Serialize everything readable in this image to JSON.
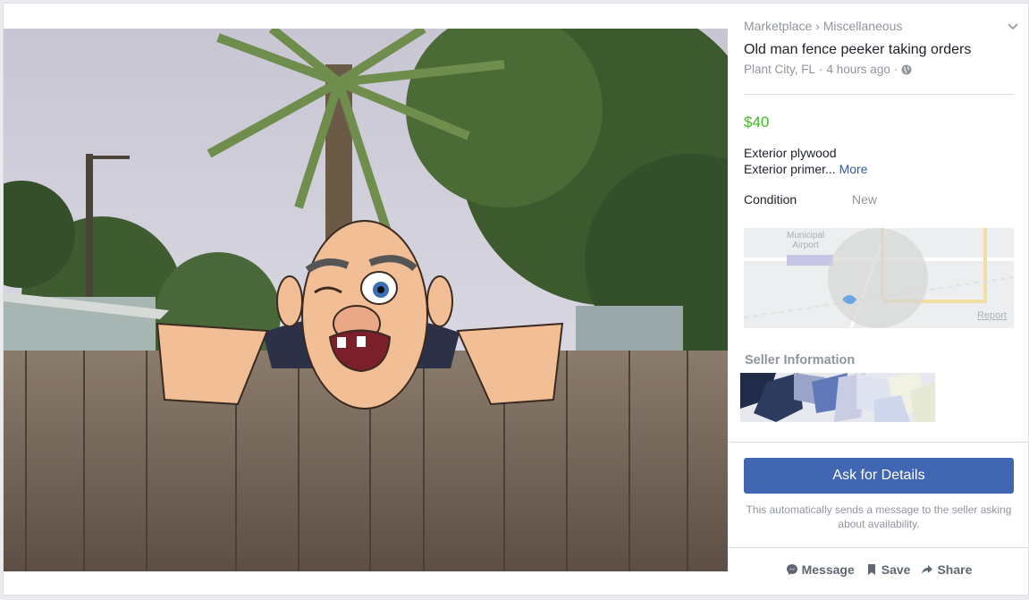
{
  "breadcrumb": {
    "category": "Marketplace",
    "separator": "›",
    "subcategory": "Miscellaneous"
  },
  "listing": {
    "title": "Old man fence peeker taking orders",
    "location": "Plant City, FL",
    "time": "4 hours ago",
    "dot": "·",
    "price": "$40",
    "description_line1": "Exterior plywood",
    "description_line2": "Exterior primer...",
    "more_label": "More",
    "condition_label": "Condition",
    "condition_value": "New"
  },
  "map": {
    "place_label_1": "Municipal",
    "place_label_2": "Airport",
    "report_label": "Report"
  },
  "seller": {
    "heading": "Seller Information"
  },
  "cta": {
    "ask_label": "Ask for Details",
    "helper_text": "This automatically sends a message to the seller asking about availability."
  },
  "actions": {
    "message_label": "Message",
    "save_label": "Save",
    "share_label": "Share"
  },
  "colors": {
    "accent": "#4267b2",
    "price": "#42b72a",
    "muted": "#90949c",
    "link": "#385898"
  },
  "icons": [
    "chevron-down-icon",
    "globe-icon",
    "messenger-icon",
    "bookmark-icon",
    "share-arrow-icon"
  ]
}
